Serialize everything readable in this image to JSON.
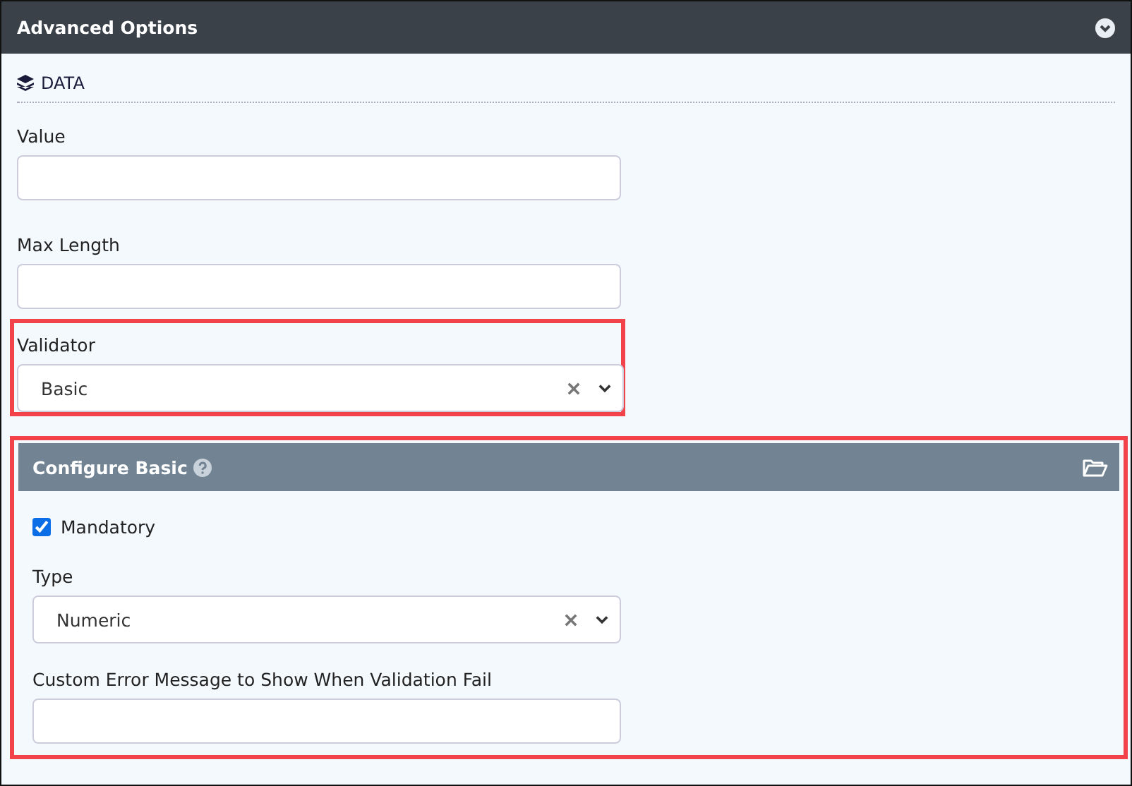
{
  "panel": {
    "title": "Advanced Options",
    "expanded": true
  },
  "section": {
    "title": "DATA"
  },
  "fields": [
    {
      "kind": "text",
      "label": "Value"
    },
    {
      "kind": "text",
      "label": "Max Length"
    },
    {
      "kind": "select",
      "label": "Validator",
      "value": "Basic",
      "highlighted": true
    }
  ],
  "configure": {
    "title": "Configure Basic",
    "highlighted": true,
    "mandatory": {
      "label": "Mandatory",
      "checked": true
    },
    "fields": [
      {
        "kind": "select",
        "label": "Type",
        "value": "Numeric"
      },
      {
        "kind": "text",
        "label": "Custom Error Message to Show When Validation Fail"
      }
    ]
  }
}
